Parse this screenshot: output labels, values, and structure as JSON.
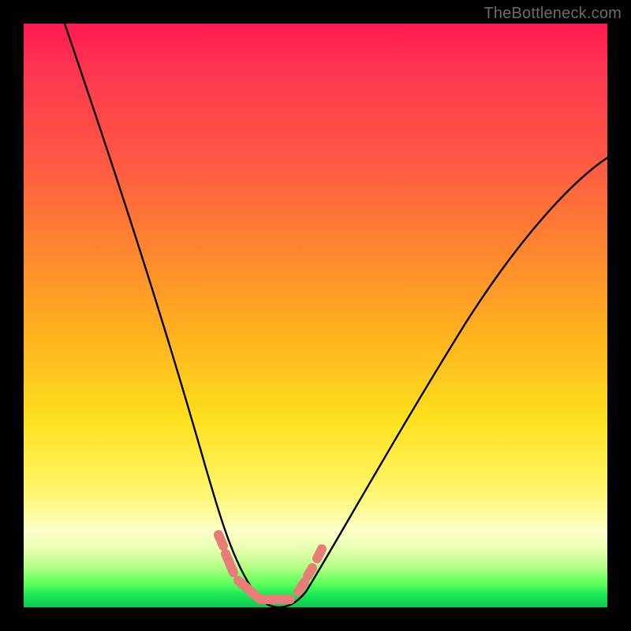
{
  "watermark": {
    "text": "TheBottleneck.com"
  },
  "chart_data": {
    "type": "line",
    "title": "",
    "xlabel": "",
    "ylabel": "",
    "xlim": [
      0,
      100
    ],
    "ylim": [
      0,
      100
    ],
    "grid": false,
    "legend": null,
    "background_gradient": {
      "direction": "vertical",
      "stops": [
        {
          "pos": 0.0,
          "color": "#ff1a4f"
        },
        {
          "pos": 0.24,
          "color": "#ff5a42"
        },
        {
          "pos": 0.54,
          "color": "#ffb41e"
        },
        {
          "pos": 0.8,
          "color": "#fff66a"
        },
        {
          "pos": 0.93,
          "color": "#b6ff87"
        },
        {
          "pos": 1.0,
          "color": "#10c84e"
        }
      ]
    },
    "series": [
      {
        "name": "bottleneck-curve",
        "color": "#000000",
        "x": [
          7,
          10,
          14,
          18,
          22,
          26,
          29,
          31,
          33,
          35,
          37,
          39,
          41,
          44,
          48,
          54,
          60,
          66,
          72,
          78,
          85,
          92,
          100
        ],
        "y": [
          100,
          90,
          78,
          66,
          55,
          43,
          33,
          26,
          19,
          12,
          6,
          2,
          0,
          0,
          3,
          10,
          19,
          28,
          37,
          46,
          55,
          63,
          71
        ]
      },
      {
        "name": "highlight-band",
        "color": "#e77d76",
        "type": "scatter",
        "x": [
          32,
          33,
          36,
          38,
          40,
          42,
          44,
          46,
          47,
          48
        ],
        "y": [
          11,
          8,
          3,
          1,
          0,
          0,
          1,
          3,
          6,
          9
        ]
      }
    ],
    "optimum_x": 41
  }
}
